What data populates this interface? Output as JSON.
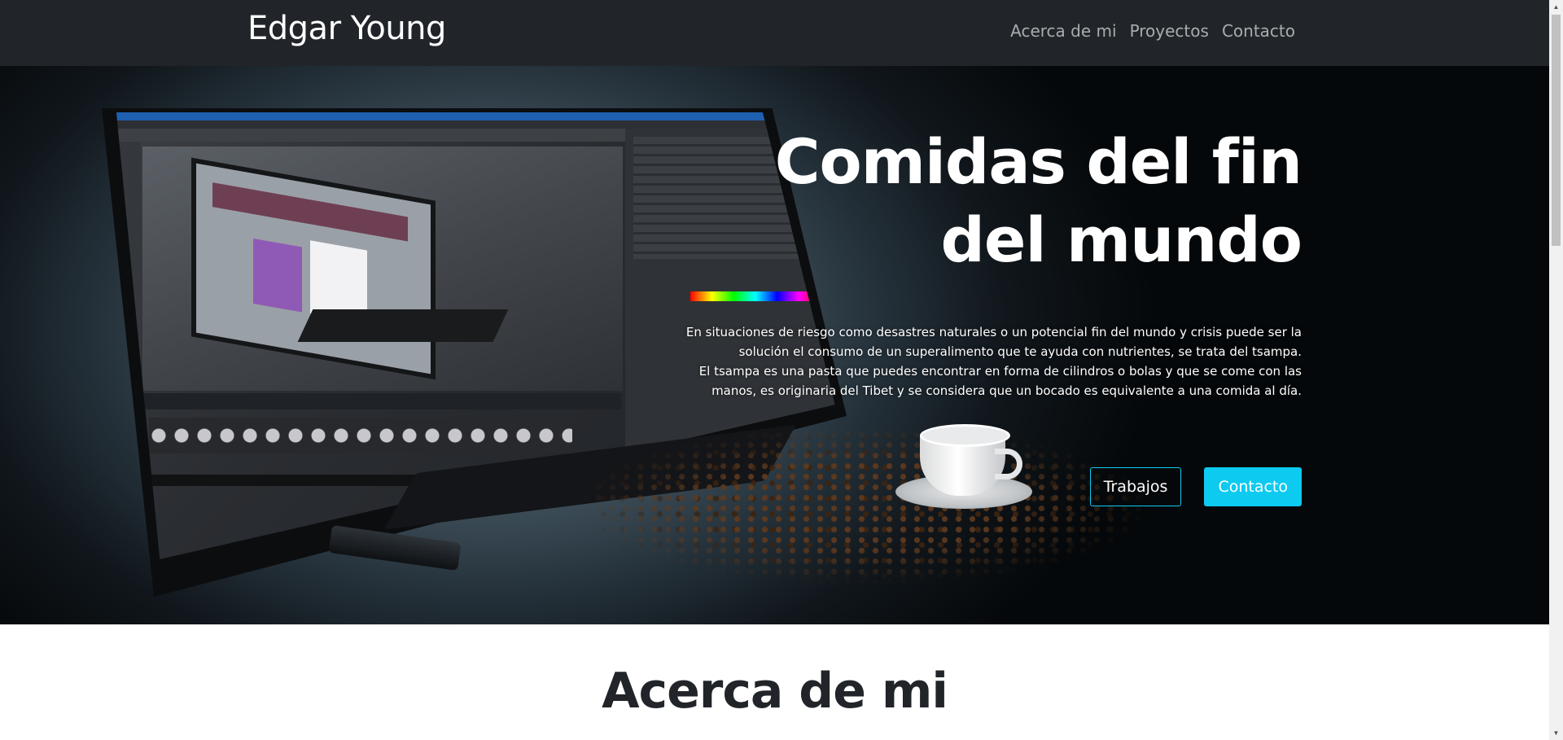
{
  "navbar": {
    "brand": "Edgar Young",
    "links": [
      "Acerca de mi",
      "Proyectos",
      "Contacto"
    ]
  },
  "hero": {
    "title_line1": "Comidas del fin",
    "title_line2": "del mundo",
    "paragraph1": "En situaciones de riesgo como desastres naturales o un potencial fin del mundo y crisis puede ser la solución el consumo de un superalimento que te ayuda con nutrientes, se trata del tsampa.",
    "paragraph2": "El tsampa es una pasta que puedes encontrar en forma de cilindros o bolas y que se come con las manos, es originaria del Tibet y se considera que un bocado es equivalente a una comida al día.",
    "btn_works": "Trabajos",
    "btn_contact": "Contacto"
  },
  "about": {
    "title": "Acerca de mi"
  },
  "colors": {
    "navbar_bg": "#212529",
    "accent_info": "#0dcaf0",
    "nav_link": "#a9acaf"
  },
  "icons": {
    "scroll_up": "▲",
    "scroll_down": "▼"
  }
}
